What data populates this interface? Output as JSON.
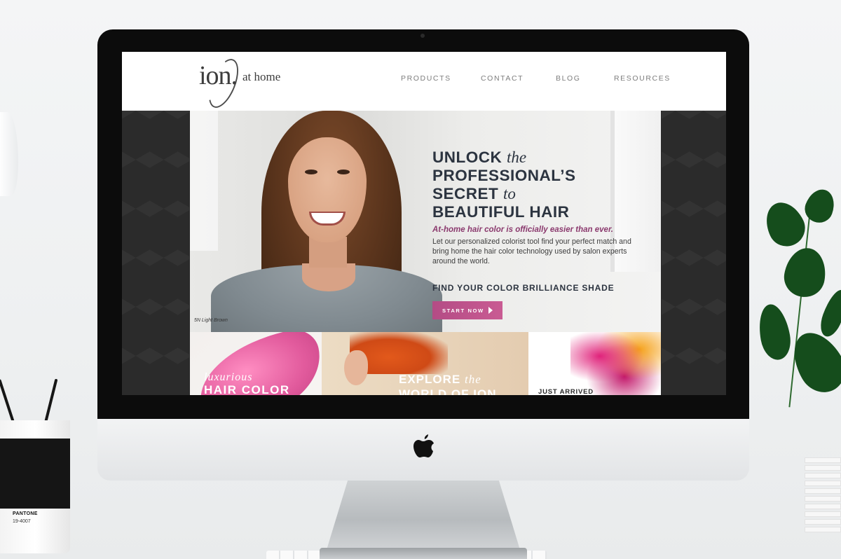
{
  "header": {
    "logo_primary": "ion.",
    "logo_secondary": "at home",
    "nav": [
      {
        "label": "PRODUCTS"
      },
      {
        "label": "CONTACT"
      },
      {
        "label": "BLOG"
      },
      {
        "label": "RESOURCES"
      }
    ]
  },
  "hero": {
    "headline_line1_bold": "UNLOCK",
    "headline_line1_italic": "the",
    "headline_line2_bold": "PROFESSIONAL’S",
    "headline_line3_bold": "SECRET",
    "headline_line3_italic": "to",
    "headline_line4_bold": "BEAUTIFUL HAIR",
    "tagline": "At-home hair color is officially easier than ever.",
    "description": "Let our personalized colorist tool find your perfect match and bring home the hair color technology used by salon experts around the world.",
    "find_heading": "FIND YOUR COLOR BRILLIANCE SHADE",
    "cta_label": "START NOW",
    "shade_caption": "5N Light Brown"
  },
  "tiles": [
    {
      "line1": "luxurious",
      "line2": "HAIR COLOR"
    },
    {
      "line1_bold": "EXPLORE",
      "line1_italic": "the",
      "line2": "WORLD OF ION"
    },
    {
      "line1": "JUST ARRIVED"
    }
  ],
  "desk": {
    "cup_brand": "PANTONE",
    "cup_code": "19-4007"
  },
  "colors": {
    "accent": "#b44c85",
    "tagline": "#8b3a6e",
    "headline": "#2c3440"
  }
}
